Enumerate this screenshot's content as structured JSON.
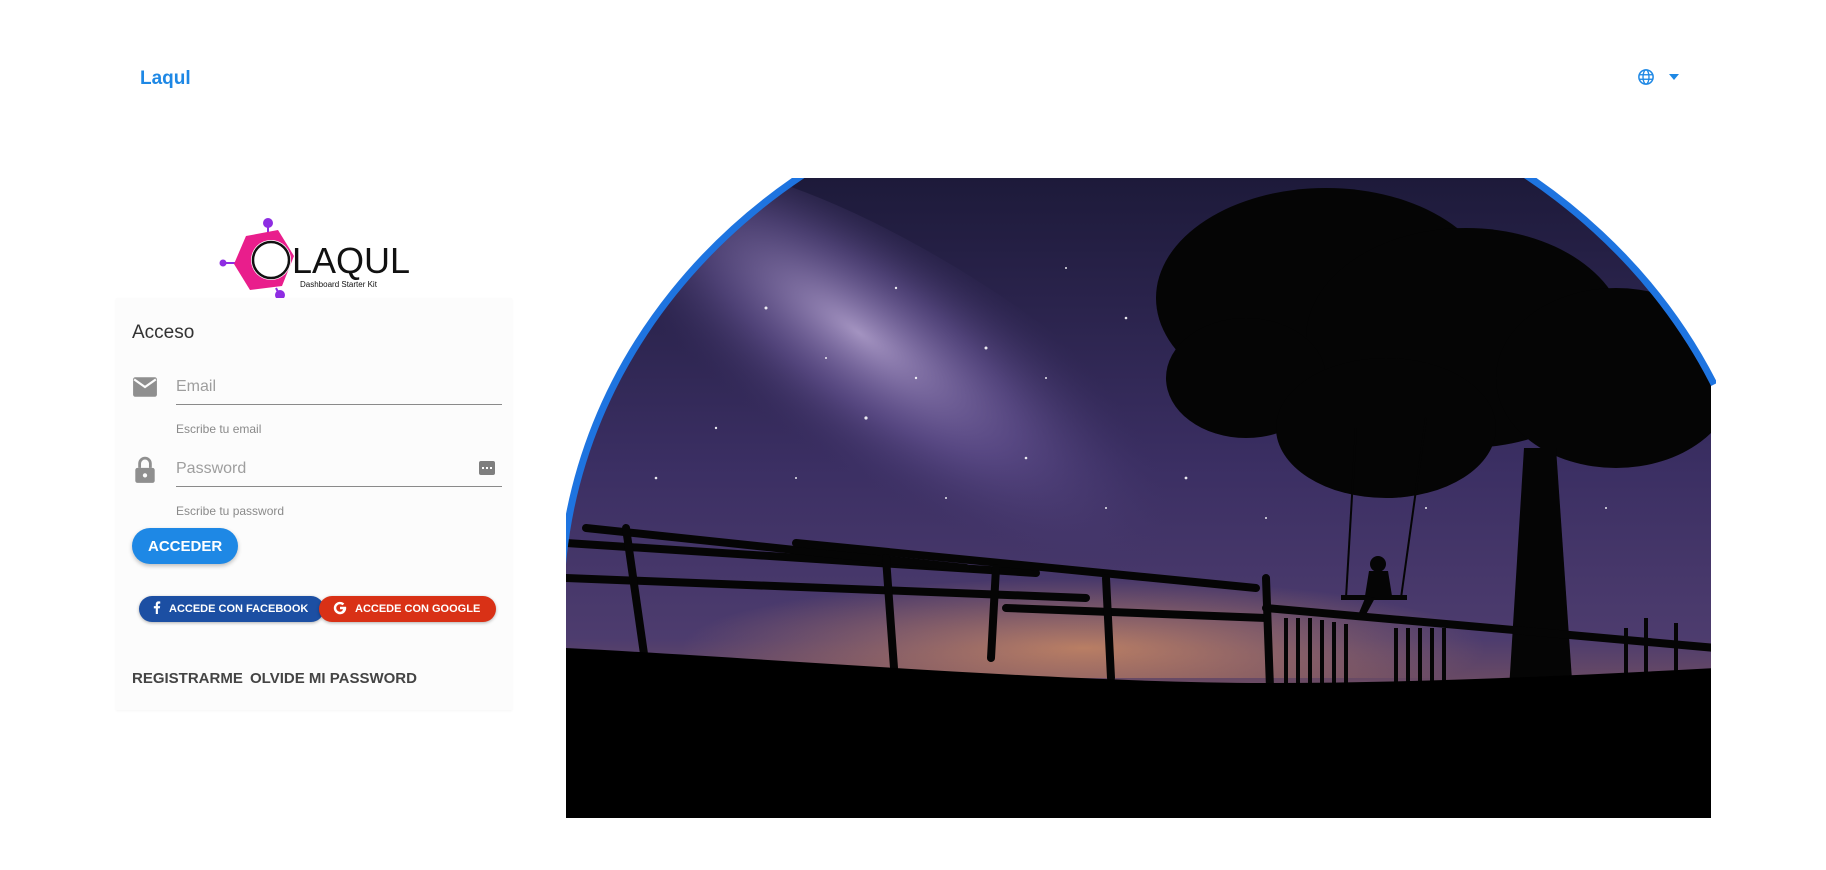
{
  "header": {
    "brand": "Laqul",
    "language_icon": "globe-icon",
    "language_menu_icon": "caret-down-icon"
  },
  "logo": {
    "wordmark": "LAQUL",
    "tagline": "Dashboard Starter Kit"
  },
  "login": {
    "title": "Acceso",
    "email": {
      "icon": "mail-icon",
      "placeholder": "Email",
      "value": "",
      "hint": "Escribe tu email"
    },
    "password": {
      "icon": "lock-icon",
      "toggle_icon": "password-dots-icon",
      "placeholder": "Password",
      "value": "",
      "hint": "Escribe tu password"
    },
    "submit_label": "ACCEDER",
    "facebook_label": "ACCEDE CON FACEBOOK",
    "google_label": "ACCEDE CON GOOGLE",
    "register_label": "REGISTRARME",
    "forgot_label": "OLVIDE MI PASSWORD"
  },
  "colors": {
    "primary": "#1e88e5",
    "facebook": "#1c4fa3",
    "google": "#d93116",
    "logo_magenta": "#e91e8c",
    "logo_purple": "#7b2ff7"
  },
  "hero": {
    "icon": "night-sky-illustration"
  }
}
